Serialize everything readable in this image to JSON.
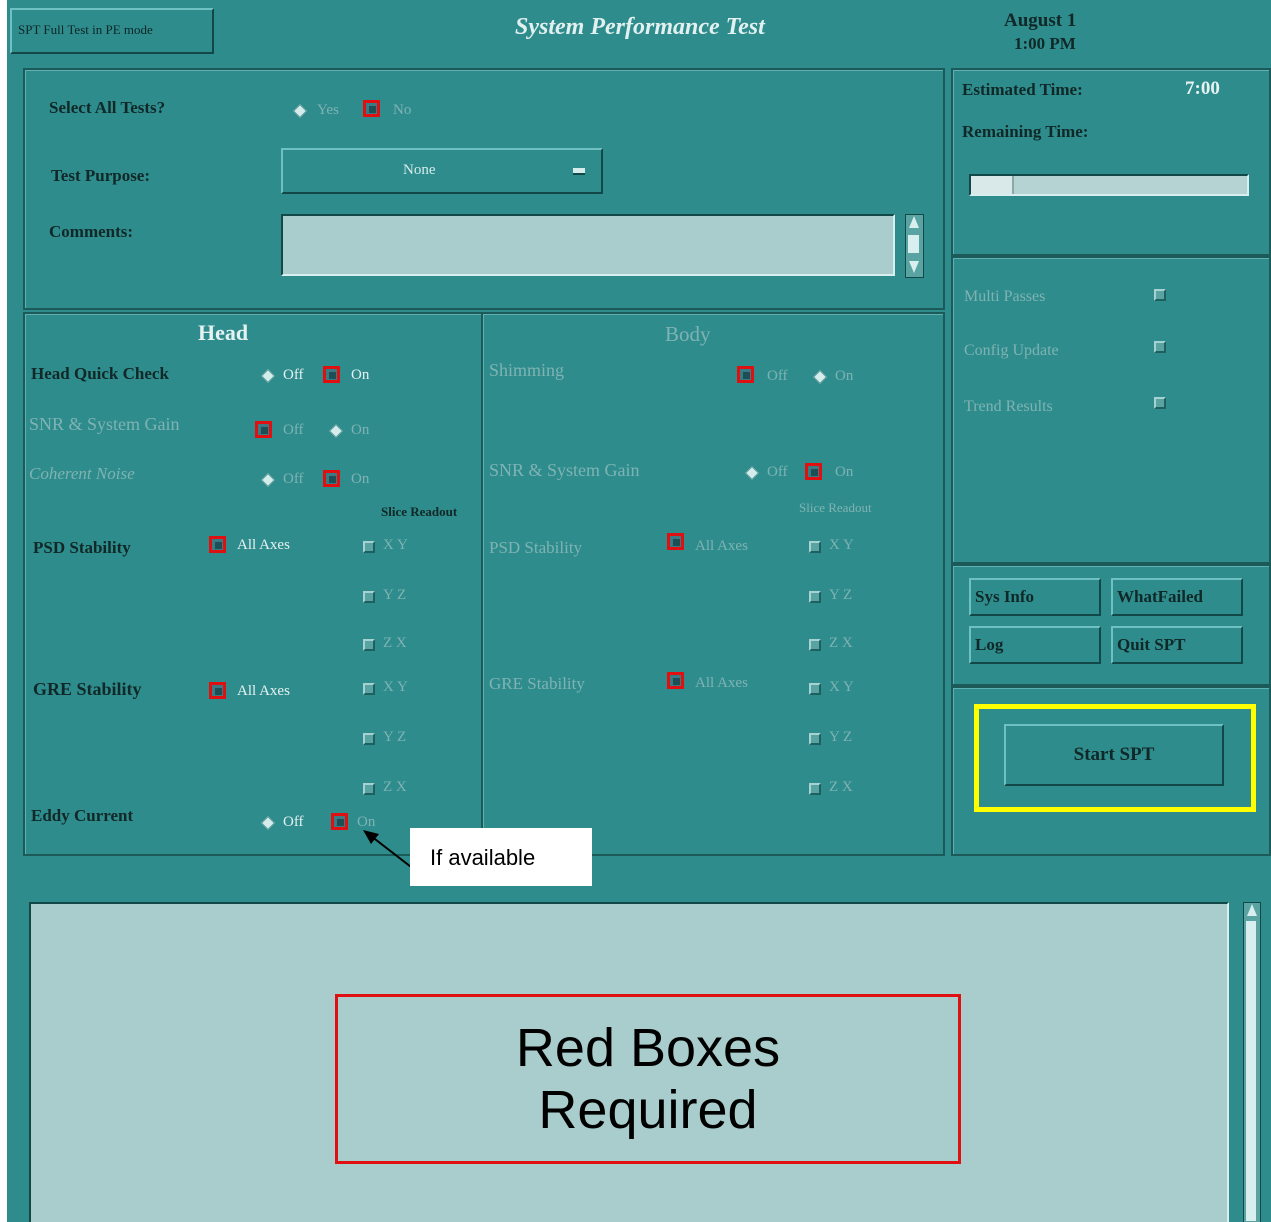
{
  "header": {
    "mode_label": "SPT Full Test in PE mode",
    "title": "System Performance Test",
    "date": "August 1",
    "time": "1:00 PM"
  },
  "top_form": {
    "select_all_label": "Select All Tests?",
    "select_all_yes": "Yes",
    "select_all_no": "No",
    "test_purpose_label": "Test Purpose:",
    "test_purpose_value": "None",
    "comments_label": "Comments:",
    "comments_value": ""
  },
  "time_panel": {
    "estimated_label": "Estimated Time:",
    "estimated_value": "7:00",
    "remaining_label": "Remaining Time:",
    "progress_fraction": 0.15
  },
  "options": {
    "multi_passes": "Multi Passes",
    "config_update": "Config Update",
    "trend_results": "Trend Results"
  },
  "buttons": {
    "sys_info": "Sys Info",
    "what_failed": "WhatFailed",
    "log": "Log",
    "quit_spt": "Quit SPT",
    "start_spt": "Start SPT"
  },
  "head": {
    "title": "Head",
    "quick_check": "Head Quick Check",
    "snr": "SNR & System Gain",
    "coherent_noise": "Coherent Noise",
    "psd_stability": "PSD Stability",
    "gre_stability": "GRE Stability",
    "eddy_current": "Eddy Current",
    "slice_readout": "Slice Readout",
    "all_axes": "All Axes",
    "off": "Off",
    "on": "On",
    "axes_rows": [
      "X Y",
      "Y Z",
      "Z X",
      "X Y",
      "Y Z",
      "Z X"
    ]
  },
  "body": {
    "title": "Body",
    "shimming": "Shimming",
    "snr": "SNR & System Gain",
    "psd_stability": "PSD Stability",
    "gre_stability": "GRE Stability",
    "slice_readout": "Slice Readout",
    "all_axes": "All Axes",
    "off": "Off",
    "on": "On",
    "axes_rows": [
      "X Y",
      "Y Z",
      "Z X",
      "X Y",
      "Y Z",
      "Z X"
    ]
  },
  "annotations": {
    "if_available": "If available",
    "red_boxes": "Red Boxes Required"
  },
  "colors": {
    "background": "#2f8c8c",
    "required_highlight": "#e01010",
    "start_highlight": "#ffff00"
  }
}
